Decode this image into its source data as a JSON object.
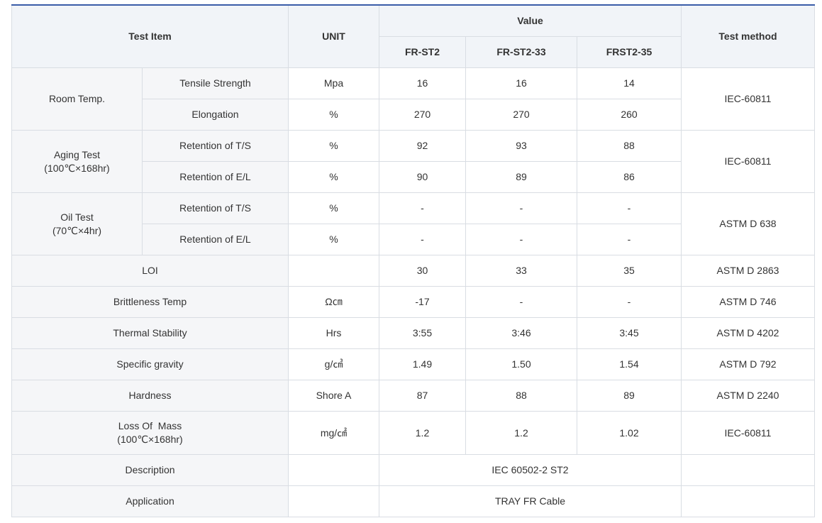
{
  "header": {
    "test_item": "Test Item",
    "unit": "UNIT",
    "value": "Value",
    "test_method": "Test method",
    "products": [
      "FR-ST2",
      "FR-ST2-33",
      "FRST2-35"
    ]
  },
  "groups": [
    {
      "label_line1": "Room Temp.",
      "label_line2": "",
      "method": "IEC-60811",
      "rows": [
        {
          "item": "Tensile Strength",
          "unit": "Mpa",
          "values": [
            "16",
            "16",
            "14"
          ]
        },
        {
          "item": "Elongation",
          "unit": "%",
          "values": [
            "270",
            "270",
            "260"
          ]
        }
      ]
    },
    {
      "label_line1": "Aging Test",
      "label_line2": "(100℃×168hr)",
      "method": "IEC-60811",
      "rows": [
        {
          "item": "Retention of T/S",
          "unit": "%",
          "values": [
            "92",
            "93",
            "88"
          ]
        },
        {
          "item": "Retention of E/L",
          "unit": "%",
          "values": [
            "90",
            "89",
            "86"
          ]
        }
      ]
    },
    {
      "label_line1": "Oil Test",
      "label_line2": "(70℃×4hr)",
      "method": "ASTM D 638",
      "rows": [
        {
          "item": "Retention of T/S",
          "unit": "%",
          "values": [
            "-",
            "-",
            "-"
          ]
        },
        {
          "item": "Retention of E/L",
          "unit": "%",
          "values": [
            "-",
            "-",
            "-"
          ]
        }
      ]
    }
  ],
  "single_rows": [
    {
      "item": "LOI",
      "unit": "",
      "values": [
        "30",
        "33",
        "35"
      ],
      "method": "ASTM D 2863"
    },
    {
      "item": "Brittleness Temp",
      "unit": "Ω㎝",
      "values": [
        "-17",
        "-",
        "-"
      ],
      "method": "ASTM D 746"
    },
    {
      "item": "Thermal Stability",
      "unit": "Hrs",
      "values": [
        "3:55",
        "3:46",
        "3:45"
      ],
      "method": "ASTM D 4202"
    },
    {
      "item": "Specific gravity",
      "unit": "g/㎤",
      "values": [
        "1.49",
        "1.50",
        "1.54"
      ],
      "method": "ASTM D 792"
    },
    {
      "item": "Hardness",
      "unit": "Shore A",
      "values": [
        "87",
        "88",
        "89"
      ],
      "method": "ASTM D 2240"
    }
  ],
  "loss_row": {
    "item_line1": "Loss Of  Mass",
    "item_line2": "(100℃×168hr)",
    "unit": "mg/㎠",
    "values": [
      "1.2",
      "1.2",
      "1.02"
    ],
    "method": "IEC-60811"
  },
  "description": {
    "label": "Description",
    "value": "IEC 60502-2 ST2"
  },
  "application": {
    "label": "Application",
    "value": "TRAY FR Cable"
  }
}
